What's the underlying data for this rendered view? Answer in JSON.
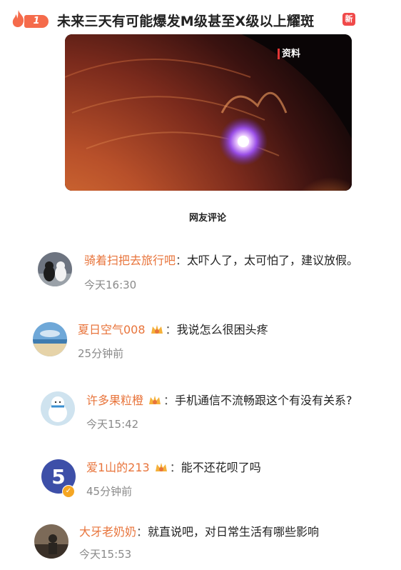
{
  "headline": {
    "rank": "1",
    "title": "未来三天有可能爆发M级甚至X级以上耀斑",
    "new_badge": "新"
  },
  "video": {
    "tag": "资料"
  },
  "comments_section": {
    "title": "网友评论"
  },
  "comments": [
    {
      "username": "骑着扫把去旅行吧",
      "separator": "：",
      "text": "太吓人了，太可怕了，建议放假。",
      "time": "今天16:30",
      "crown": false,
      "verified": false
    },
    {
      "username": "夏日空气008",
      "separator": "：",
      "text": "我说怎么很困头疼",
      "time": "25分钟前",
      "crown": true,
      "verified": false
    },
    {
      "username": "许多果粒橙",
      "separator": "：",
      "text": "手机通信不流畅跟这个有没有关系?",
      "time": "今天15:42",
      "crown": true,
      "verified": false
    },
    {
      "username": "爱1山的213",
      "separator": "：",
      "text": "能不还花呗了吗",
      "time": "45分钟前",
      "crown": true,
      "verified": true
    },
    {
      "username": "大牙老奶奶",
      "separator": "：",
      "text": "就直说吧，对日常生活有哪些影响",
      "time": "今天15:53",
      "crown": false,
      "verified": false
    }
  ],
  "colors": {
    "username": "#e8743b",
    "badge": "#f56b4b",
    "new": "#f04a4a",
    "time": "#8a8a8a"
  }
}
